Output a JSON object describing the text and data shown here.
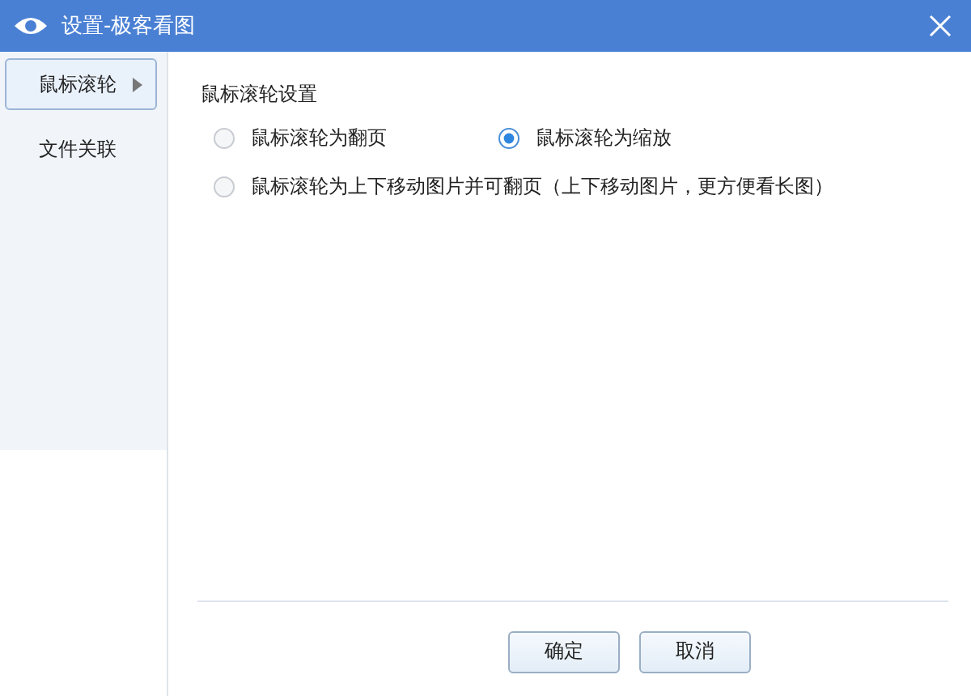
{
  "window": {
    "title": "设置-极客看图"
  },
  "sidebar": {
    "items": [
      {
        "label": "鼠标滚轮",
        "selected": true
      },
      {
        "label": "文件关联",
        "selected": false
      }
    ]
  },
  "section": {
    "title": "鼠标滚轮设置",
    "options": [
      {
        "label": "鼠标滚轮为翻页",
        "selected": false
      },
      {
        "label": "鼠标滚轮为缩放",
        "selected": true
      },
      {
        "label": "鼠标滚轮为上下移动图片并可翻页（上下移动图片，更方便看长图）",
        "selected": false
      }
    ]
  },
  "buttons": [
    "确定",
    "取消"
  ]
}
